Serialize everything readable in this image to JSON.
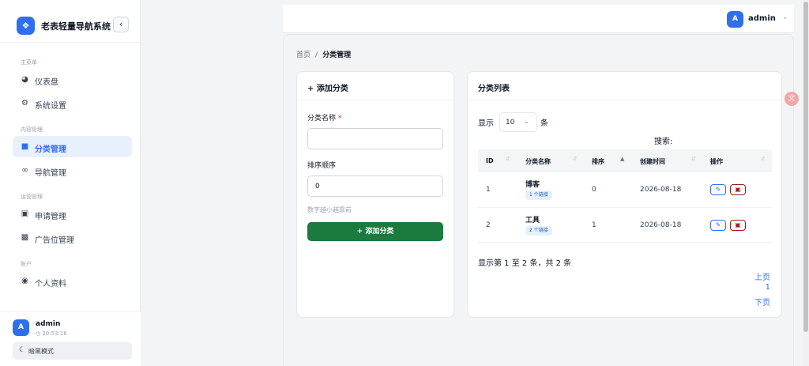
{
  "brand": {
    "title": "老表轻量导航系统",
    "collapse_icon": "‹"
  },
  "sidebar": {
    "sections": [
      {
        "label": "主菜单"
      },
      {
        "label": "内容管理"
      },
      {
        "label": "运营管理"
      },
      {
        "label": "账户"
      }
    ],
    "items": [
      {
        "label": "仪表盘",
        "icon": "dashboard-icon"
      },
      {
        "label": "系统设置",
        "icon": "gear-icon"
      },
      {
        "label": "分类管理",
        "icon": "folder-icon"
      },
      {
        "label": "导航管理",
        "icon": "link-icon"
      },
      {
        "label": "申请管理",
        "icon": "inbox-icon"
      },
      {
        "label": "广告位管理",
        "icon": "ad-icon"
      },
      {
        "label": "个人资料",
        "icon": "user-icon"
      }
    ],
    "active_item": "分类管理"
  },
  "user": {
    "avatar": "A",
    "name": "admin",
    "time": "20:53:18",
    "dark_mode_label": "暗黑模式"
  },
  "topbar": {
    "avatar": "A",
    "name": "admin"
  },
  "breadcrumb": {
    "home": "首页",
    "separator": "/",
    "current": "分类管理"
  },
  "add_form": {
    "title": "添加分类",
    "name_label": "分类名称",
    "required_mark": "*",
    "name_value": "",
    "order_label": "排序顺序",
    "order_value": "0",
    "order_hint": "数字越小越靠前",
    "submit_label": "+ 添加分类"
  },
  "list": {
    "title": "分类列表",
    "show_prefix": "显示",
    "page_size": "10",
    "show_suffix": "条",
    "search_label": "搜索:",
    "columns": [
      "ID",
      "分类名称",
      "排序",
      "创建时间",
      "操作"
    ],
    "rows": [
      {
        "id": "1",
        "name": "博客",
        "links": "1 个链接",
        "order": "0",
        "created": "2026-08-18"
      },
      {
        "id": "2",
        "name": "工具",
        "links": "2 个链接",
        "order": "1",
        "created": "2026-08-18"
      }
    ],
    "info": "显示第 1 至 2 条，共 2 条",
    "pager": {
      "prev": "上页",
      "page": "1",
      "next": "下页"
    }
  },
  "colors": {
    "accent": "#2f6fed",
    "primary_button": "#1b7a3d",
    "danger": "#9b1c1c"
  }
}
